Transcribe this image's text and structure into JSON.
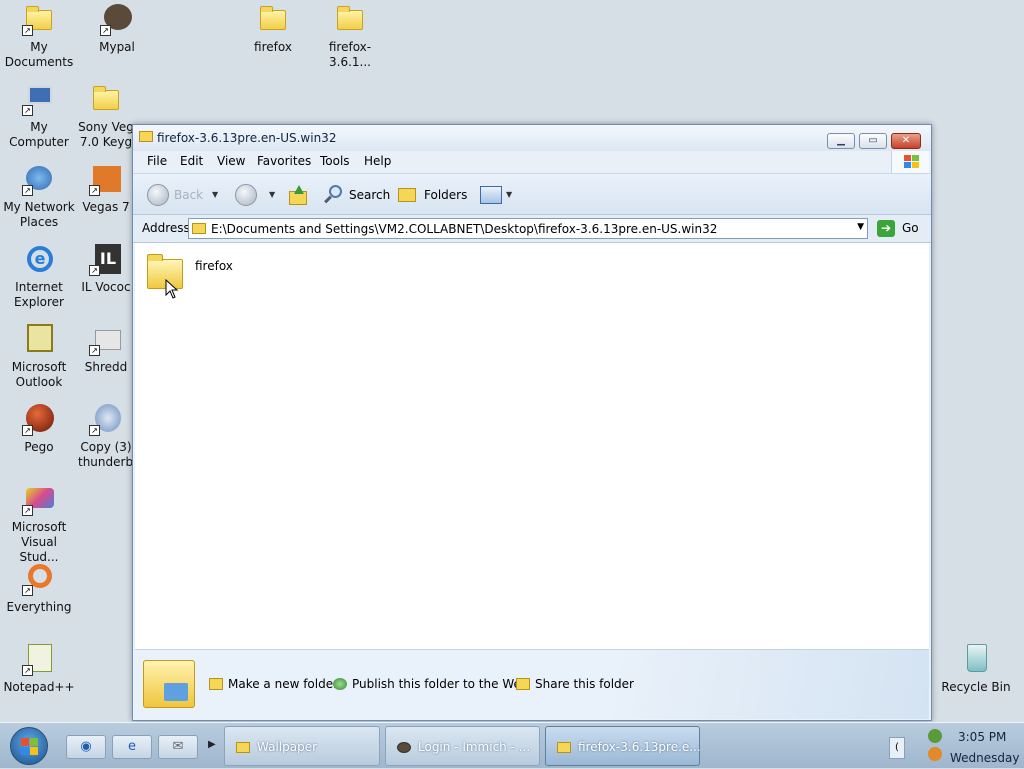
{
  "desktop": {
    "icons": [
      {
        "label": "My Documents",
        "icon": "my-documents-icon"
      },
      {
        "label": "Mypal",
        "icon": "mypal-icon"
      },
      {
        "label": "firefox",
        "icon": "folder-icon"
      },
      {
        "label": "firefox-3.6.1...",
        "icon": "folder-icon"
      },
      {
        "label": "My Computer",
        "icon": "my-computer-icon"
      },
      {
        "label": "Sony Veg 7.0 Keyg",
        "icon": "folder-icon"
      },
      {
        "label": "My Network Places",
        "icon": "network-places-icon"
      },
      {
        "label": "Vegas 7",
        "icon": "vegas-icon"
      },
      {
        "label": "Internet Explorer",
        "icon": "internet-explorer-icon"
      },
      {
        "label": "IL Vococ",
        "icon": "il-vocoder-icon"
      },
      {
        "label": "Microsoft Outlook",
        "icon": "outlook-icon"
      },
      {
        "label": "Shredd",
        "icon": "shredder-icon"
      },
      {
        "label": "Pego",
        "icon": "pego-icon"
      },
      {
        "label": "Copy (3) thunderbi",
        "icon": "thunderbird-icon"
      },
      {
        "label": "Microsoft Visual Stud...",
        "icon": "visual-studio-icon"
      },
      {
        "label": "Everything",
        "icon": "everything-icon"
      },
      {
        "label": "Notepad++",
        "icon": "notepadpp-icon"
      },
      {
        "label": "Recycle Bin",
        "icon": "recycle-bin-icon"
      }
    ]
  },
  "window": {
    "title": "firefox-3.6.13pre.en-US.win32",
    "menu": [
      "File",
      "Edit",
      "View",
      "Favorites",
      "Tools",
      "Help"
    ],
    "toolbar": {
      "back": "Back",
      "search": "Search",
      "folders": "Folders"
    },
    "address": {
      "label": "Address",
      "value": "E:\\Documents and Settings\\VM2.COLLABNET\\Desktop\\firefox-3.6.13pre.en-US.win32",
      "go": "Go"
    },
    "items": [
      {
        "name": "firefox"
      }
    ],
    "tasks": [
      "Make a new folder",
      "Publish this folder to the Web",
      "Share this folder"
    ]
  },
  "taskbar": {
    "tasks": [
      {
        "label": "Wallpaper"
      },
      {
        "label": "Login - Immich - ..."
      },
      {
        "label": "firefox-3.6.13pre.e..."
      }
    ],
    "clock": {
      "time": "3:05 PM",
      "day": "Wednesday"
    }
  }
}
